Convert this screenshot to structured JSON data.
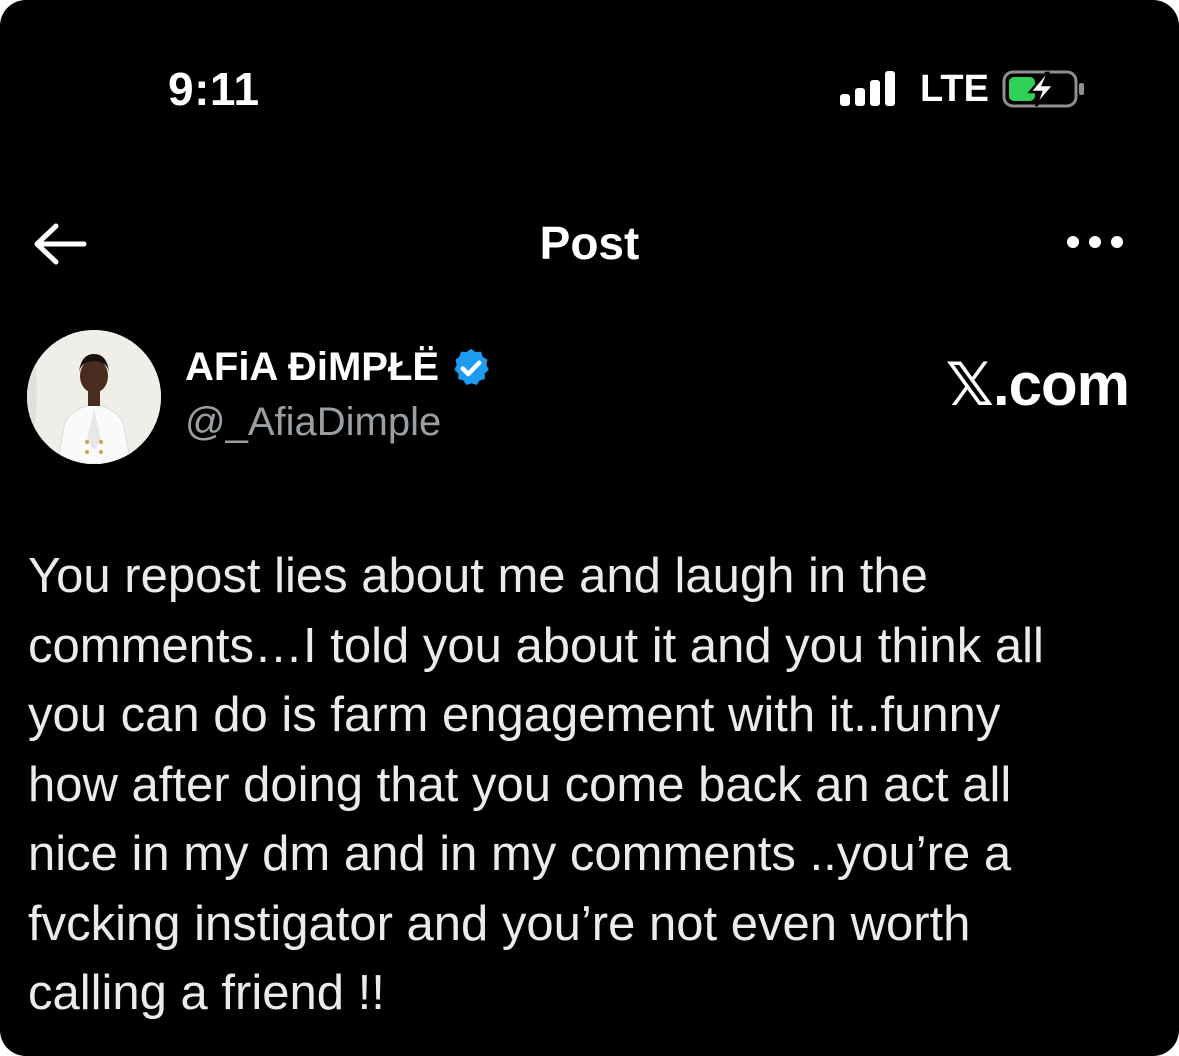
{
  "status_bar": {
    "time": "9:11",
    "network": "LTE",
    "signal_icon": "cellular-signal-icon",
    "battery_icon": "battery-charging-icon",
    "battery_color": "#30d158"
  },
  "nav": {
    "back_icon": "arrow-left-icon",
    "title": "Post",
    "more_icon": "more-horizontal-icon"
  },
  "author": {
    "display_name": "AFiA ĐiMPŁË",
    "handle": "@_AfiaDimple",
    "verified": true,
    "verified_color": "#1d9bf0"
  },
  "brand": "𝕏.com",
  "post": {
    "text": "You repost lies about me and laugh in the\ncomments…I told you about it and you think all\nyou can do is farm engagement with it..funny\nhow after doing that you come back an act all\nnice in my dm and in my comments ..you’re a\nfvcking instigator and you’re not even worth\ncalling a friend !!"
  }
}
